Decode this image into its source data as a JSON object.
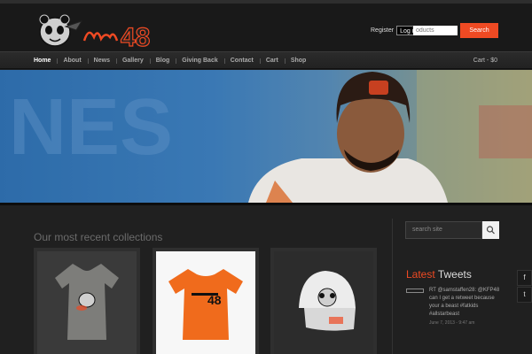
{
  "brand": {
    "logo_text": "48"
  },
  "header": {
    "register_label": "Register",
    "login_label": "Log in",
    "search_placeholder": "oducts",
    "search_button": "Search"
  },
  "nav": {
    "items": [
      {
        "label": "Home"
      },
      {
        "label": "About"
      },
      {
        "label": "News"
      },
      {
        "label": "Gallery"
      },
      {
        "label": "Blog"
      },
      {
        "label": "Giving Back"
      },
      {
        "label": "Contact"
      },
      {
        "label": "Cart"
      },
      {
        "label": "Shop"
      }
    ],
    "cart_summary": "Cart - $0"
  },
  "main": {
    "section_title": "Our most recent collections",
    "products": [
      {
        "name": "gray-tshirt"
      },
      {
        "name": "orange-tshirt",
        "print_text": "48"
      },
      {
        "name": "white-cap"
      }
    ]
  },
  "sidebar": {
    "search_placeholder": "search site",
    "tweets_title_accent": "Latest",
    "tweets_title_rest": "Tweets",
    "tweet_text": "RT @samstaffen28: @KFP48 can I get a retweet because your a beast #fatkids #allstarbeast",
    "tweet_date": "June 7, 2013 - 9:47 am"
  },
  "social": {
    "facebook_glyph": "f",
    "twitter_glyph": "t"
  },
  "colors": {
    "accent": "#ef4a23",
    "background": "#1e1e1e"
  }
}
